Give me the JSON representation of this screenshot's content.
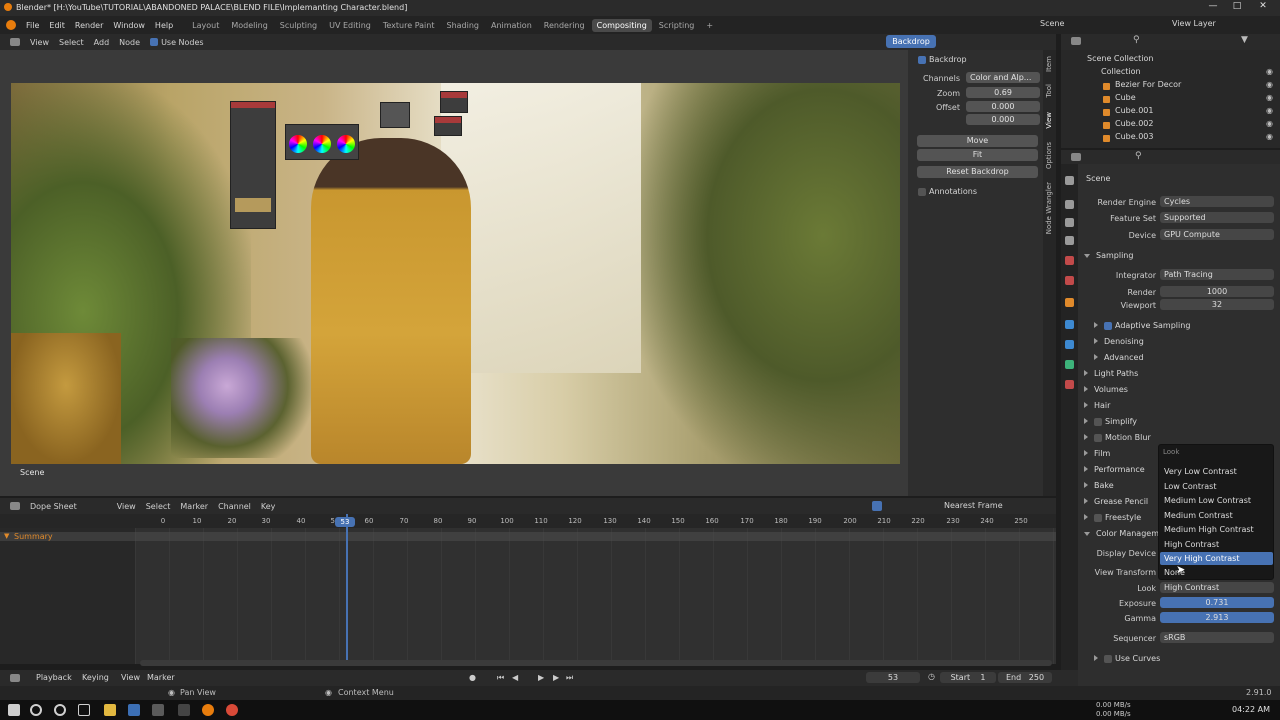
{
  "window": {
    "title": "Blender* [H:\\YouTube\\TUTORIAL\\ABANDONED PALACE\\BLEND FILE\\Implemanting Character.blend]"
  },
  "menu": {
    "items": [
      "File",
      "Edit",
      "Render",
      "Window",
      "Help"
    ]
  },
  "workspaces": {
    "tabs": [
      "Layout",
      "Modeling",
      "Sculpting",
      "UV Editing",
      "Texture Paint",
      "Shading",
      "Animation",
      "Rendering",
      "Compositing",
      "Scripting"
    ],
    "active": "Compositing"
  },
  "topright": {
    "scene": "Scene",
    "view_layer": "View Layer"
  },
  "node_editor": {
    "menu": [
      "View",
      "Select",
      "Add",
      "Node"
    ],
    "use_nodes_label": "Use Nodes",
    "backdrop_button": "Backdrop",
    "scene_label": "Scene"
  },
  "npanel": {
    "backdrop_title": "Backdrop",
    "channels_label": "Channels",
    "channels_value": "Color and Alp...",
    "zoom_label": "Zoom",
    "zoom_value": "0.69",
    "offset_label": "Offset",
    "offset_x": "0.000",
    "offset_y": "0.000",
    "move_btn": "Move",
    "fit_btn": "Fit",
    "reset_btn": "Reset Backdrop",
    "annotations": "Annotations",
    "tabs": [
      "Item",
      "Tool",
      "View",
      "Options",
      "Node Wrangler"
    ]
  },
  "outliner": {
    "scene_collection": "Scene Collection",
    "collection": "Collection",
    "items": [
      "Bezier For Decor",
      "Cube",
      "Cube.001",
      "Cube.002",
      "Cube.003"
    ]
  },
  "properties": {
    "context": "Scene",
    "render_engine_label": "Render Engine",
    "render_engine": "Cycles",
    "feature_set_label": "Feature Set",
    "feature_set": "Supported",
    "device_label": "Device",
    "device": "GPU Compute",
    "sampling": "Sampling",
    "integrator_label": "Integrator",
    "integrator": "Path Tracing",
    "render_label": "Render",
    "render_value": "1000",
    "viewport_label": "Viewport",
    "viewport_value": "32",
    "adaptive_sampling": "Adaptive Sampling",
    "denoising": "Denoising",
    "advanced": "Advanced",
    "sections": [
      "Light Paths",
      "Volumes",
      "Hair",
      "Simplify",
      "Motion Blur",
      "Film",
      "Performance",
      "Bake",
      "Grease Pencil",
      "Freestyle",
      "Color Management"
    ],
    "display_device_label": "Display Device",
    "view_transform_label": "View Transform",
    "look_label": "Look",
    "look_value": "High Contrast",
    "exposure_label": "Exposure",
    "exposure_value": "0.731",
    "gamma_label": "Gamma",
    "gamma_value": "2.913",
    "sequencer_label": "Sequencer",
    "sequencer_value": "sRGB",
    "use_curves": "Use Curves"
  },
  "look_dropdown": {
    "header": "Look",
    "options": [
      "Very Low Contrast",
      "Low Contrast",
      "Medium Low Contrast",
      "Medium Contrast",
      "Medium High Contrast",
      "High Contrast",
      "Very High Contrast",
      "None"
    ],
    "highlighted": "Very High Contrast"
  },
  "dopesheet": {
    "mode": "Dope Sheet",
    "menu": [
      "View",
      "Select",
      "Marker",
      "Channel",
      "Key"
    ],
    "snap": "Nearest Frame",
    "summary": "Summary",
    "ticks": [
      "0",
      "10",
      "20",
      "30",
      "40",
      "50",
      "60",
      "70",
      "80",
      "90",
      "100",
      "110",
      "120",
      "130",
      "140",
      "150",
      "160",
      "170",
      "180",
      "190",
      "200",
      "210",
      "220",
      "230",
      "240",
      "250"
    ],
    "current_frame": "53"
  },
  "timeline": {
    "menu": [
      "Playback",
      "Keying",
      "View",
      "Marker"
    ],
    "current_frame": "53",
    "start_label": "Start",
    "start": "1",
    "end_label": "End",
    "end": "250"
  },
  "status": {
    "pan_view": "Pan View",
    "context_menu": "Context Menu",
    "net_up": "0.00 MB/s",
    "net_down": "0.00 MB/s",
    "version": "2.91.0"
  },
  "taskbar": {
    "clock": "04:22 AM"
  },
  "colors": {
    "accent": "#4772b3",
    "orange": "#e08a2b"
  }
}
